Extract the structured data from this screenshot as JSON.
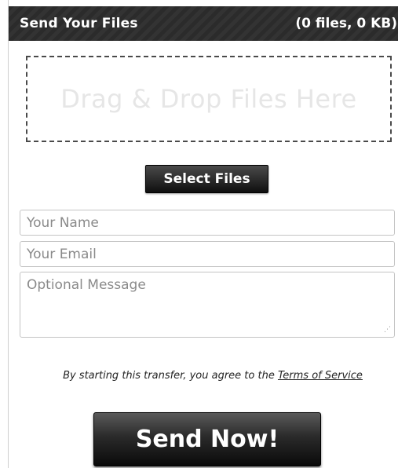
{
  "header": {
    "title": "Send Your Files",
    "count": "(0 files, 0 KB)"
  },
  "dropzone": {
    "text": "Drag & Drop Files Here"
  },
  "select_button": {
    "label": "Select Files"
  },
  "form": {
    "name_placeholder": "Your Name",
    "email_placeholder": "Your Email",
    "message_placeholder": "Optional Message"
  },
  "terms": {
    "prefix": "By starting this transfer, you agree to the ",
    "link": "Terms of Service"
  },
  "send_button": {
    "label": "Send Now!"
  }
}
